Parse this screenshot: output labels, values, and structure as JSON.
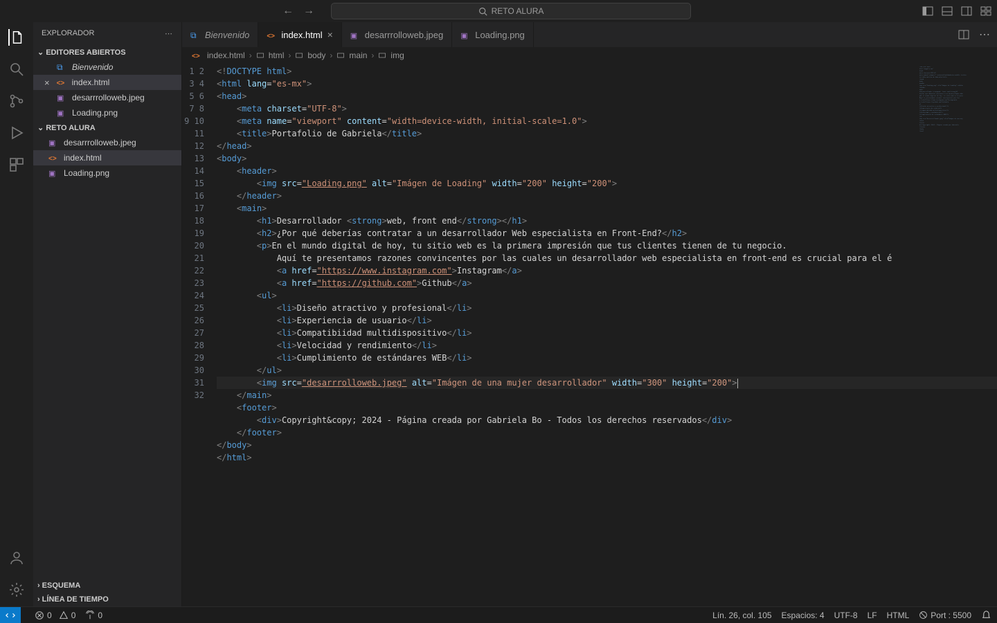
{
  "titlebar": {
    "search_text": "RETO ALURA"
  },
  "sidebar": {
    "title": "EXPLORADOR",
    "open_editors_label": "EDITORES ABIERTOS",
    "open_editors": [
      {
        "label": "Bienvenido",
        "icon": "vsblue",
        "italic": true
      },
      {
        "label": "index.html",
        "icon": "html",
        "closable": true,
        "selected": true
      },
      {
        "label": "desarrrolloweb.jpeg",
        "icon": "img"
      },
      {
        "label": "Loading.png",
        "icon": "img"
      }
    ],
    "project_label": "RETO ALURA",
    "project_files": [
      {
        "label": "desarrrolloweb.jpeg",
        "icon": "img"
      },
      {
        "label": "index.html",
        "icon": "html",
        "selected": true
      },
      {
        "label": "Loading.png",
        "icon": "img"
      }
    ],
    "outline_label": "ESQUEMA",
    "timeline_label": "LÍNEA DE TIEMPO"
  },
  "tabs": [
    {
      "label": "Bienvenido",
      "icon": "vsblue",
      "italic": true
    },
    {
      "label": "index.html",
      "icon": "html",
      "active": true,
      "closable": true
    },
    {
      "label": "desarrrolloweb.jpeg",
      "icon": "img"
    },
    {
      "label": "Loading.png",
      "icon": "img"
    }
  ],
  "breadcrumbs": [
    "index.html",
    "html",
    "body",
    "main",
    "img"
  ],
  "code_lines": [
    "<!DOCTYPE html>",
    "<html lang=\"es-mx\">",
    "<head>",
    "    <meta charset=\"UTF-8\">",
    "    <meta name=\"viewport\" content=\"width=device-width, initial-scale=1.0\">",
    "    <title>Portafolio de Gabriela</title>",
    "</head>",
    "<body>",
    "    <header>",
    "        <img src=\"Loading.png\" alt=\"Imágen de Loading\" width=\"200\" height=\"200\">",
    "    </header>",
    "    <main>",
    "        <h1>Desarrollador <strong>web, front end</strong></h1>",
    "        <h2>¿Por qué deberías contratar a un desarrollador Web especialista en Front-End?</h2>",
    "        <p>En el mundo digital de hoy, tu sitio web es la primera impresión que tus clientes tienen de tu negocio.",
    "            Aquí te presentamos razones convincentes por las cuales un desarrollador web especialista en front-end es crucial para el é",
    "            <a href=\"https://www.instagram.com\">Instagram</a>",
    "            <a href=\"https://github.com\">Github</a>",
    "        <ul>",
    "            <li>Diseño atractivo y profesional</li>",
    "            <li>Experiencia de usuario</li>",
    "            <li>Compatibiidad multidispositivo</li>",
    "            <li>Velocidad y rendimiento</li>",
    "            <li>Cumplimiento de estándares WEB</li>",
    "        </ul>",
    "        <img src=\"desarrrolloweb.jpeg\" alt=\"Imágen de una mujer desarrollador\" width=\"300\" height=\"200\">",
    "    </main>",
    "    <footer>",
    "        <div>Copyright&copy; 2024 - Página creada por Gabriela Bo - Todos los derechos reservados</div>",
    "    </footer>",
    "</body>",
    "</html>"
  ],
  "active_line": 26,
  "statusbar": {
    "errors": "0",
    "warnings": "0",
    "ports": "0",
    "linecol": "Lín. 26, col. 105",
    "spaces": "Espacios: 4",
    "encoding": "UTF-8",
    "eol": "LF",
    "lang": "HTML",
    "port": "Port : 5500"
  }
}
